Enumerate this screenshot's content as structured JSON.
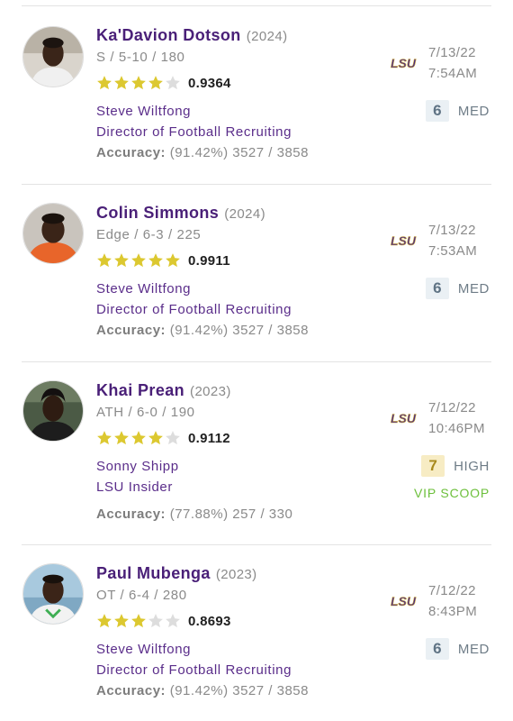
{
  "colors": {
    "name": "#4a2078",
    "author": "#5a2d8a",
    "star_filled": "#dcc830",
    "star_empty": "#dddddd",
    "vip": "#6cbf3b",
    "lsu_logo": "#4b2a84"
  },
  "logo_text": "LSU",
  "predictions": [
    {
      "name": "Ka'Davion Dotson",
      "year": "(2024)",
      "meta": "S / 5-10 / 180",
      "stars": 4,
      "rating": "0.9364",
      "author": "Steve Wiltfong",
      "role": "Director of Football Recruiting",
      "accuracy_label": "Accuracy:",
      "accuracy_value": "(91.42%) 3527 / 3858",
      "date": "7/13/22",
      "time": "7:54AM",
      "confidence": "6",
      "confidence_label": "MED",
      "vip": ""
    },
    {
      "name": "Colin Simmons",
      "year": "(2024)",
      "meta": "Edge / 6-3 / 225",
      "stars": 5,
      "rating": "0.9911",
      "author": "Steve Wiltfong",
      "role": "Director of Football Recruiting",
      "accuracy_label": "Accuracy:",
      "accuracy_value": "(91.42%) 3527 / 3858",
      "date": "7/13/22",
      "time": "7:53AM",
      "confidence": "6",
      "confidence_label": "MED",
      "vip": ""
    },
    {
      "name": "Khai Prean",
      "year": "(2023)",
      "meta": "ATH / 6-0 / 190",
      "stars": 4,
      "rating": "0.9112",
      "author": "Sonny Shipp",
      "role": "LSU Insider",
      "accuracy_label": "Accuracy:",
      "accuracy_value": "(77.88%) 257 / 330",
      "date": "7/12/22",
      "time": "10:46PM",
      "confidence": "7",
      "confidence_label": "HIGH",
      "vip": "VIP SCOOP"
    },
    {
      "name": "Paul Mubenga",
      "year": "(2023)",
      "meta": "OT / 6-4 / 280",
      "stars": 3,
      "rating": "0.8693",
      "author": "Steve Wiltfong",
      "role": "Director of Football Recruiting",
      "accuracy_label": "Accuracy:",
      "accuracy_value": "(91.42%) 3527 / 3858",
      "date": "7/12/22",
      "time": "8:43PM",
      "confidence": "6",
      "confidence_label": "MED",
      "vip": ""
    }
  ]
}
